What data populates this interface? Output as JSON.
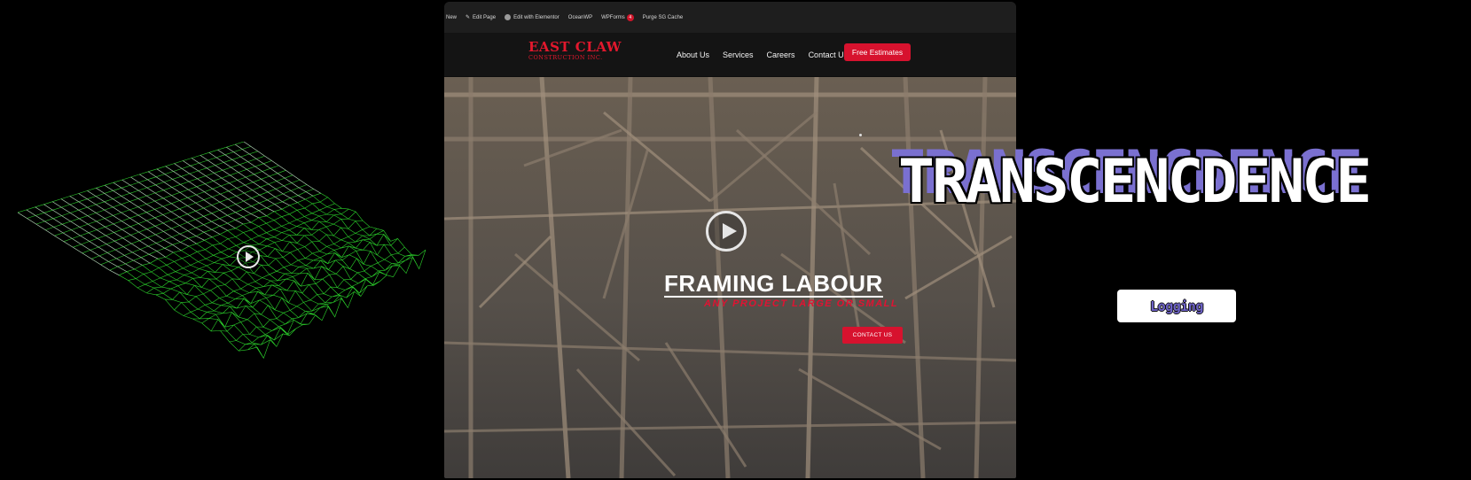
{
  "adminbar": {
    "items": [
      "New",
      "Edit Page",
      "Edit with Elementor",
      "OceanWP",
      "WPForms",
      "Purge SG Cache"
    ],
    "wpforms_count": "4"
  },
  "site": {
    "logo_line1": "EAST CLAW",
    "logo_line2": "CONSTRUCTION INC.",
    "nav": [
      "About Us",
      "Services",
      "Careers",
      "Contact Us"
    ],
    "cta": "Free Estimates"
  },
  "hero": {
    "title": "FRAMING LABOUR",
    "subtitle": "ANY PROJECT LARGE OR SMALL",
    "button": "CONTACT US"
  },
  "overlay": {
    "title": "TRANSCENCDENCE",
    "logging_button": "Logging"
  },
  "colors": {
    "brand_red": "#d7122e",
    "purple": "#7a70d0",
    "wire_green": "#2bd12b"
  },
  "icons": [
    "play-icon",
    "pencil-icon",
    "elementor-icon"
  ]
}
